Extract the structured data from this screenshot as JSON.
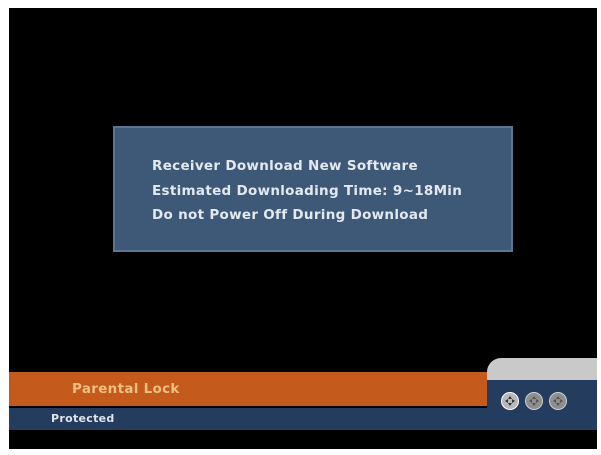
{
  "dialog": {
    "line1": "Receiver Download New Software",
    "line2": "Estimated Downloading Time: 9~18Min",
    "line3": "Do not Power Off During Download"
  },
  "bottom_bar": {
    "title": "Parental Lock",
    "status": "Protected"
  },
  "nav_icons": [
    "navigation-pad-icon",
    "navigation-pad-icon",
    "navigation-pad-icon"
  ],
  "colors": {
    "screen_background": "#000000",
    "dialog_background": "#3e5878",
    "orange_bar": "#c45a1c",
    "status_bar": "#243c5e",
    "icon_panel": "#c9c9c9"
  }
}
